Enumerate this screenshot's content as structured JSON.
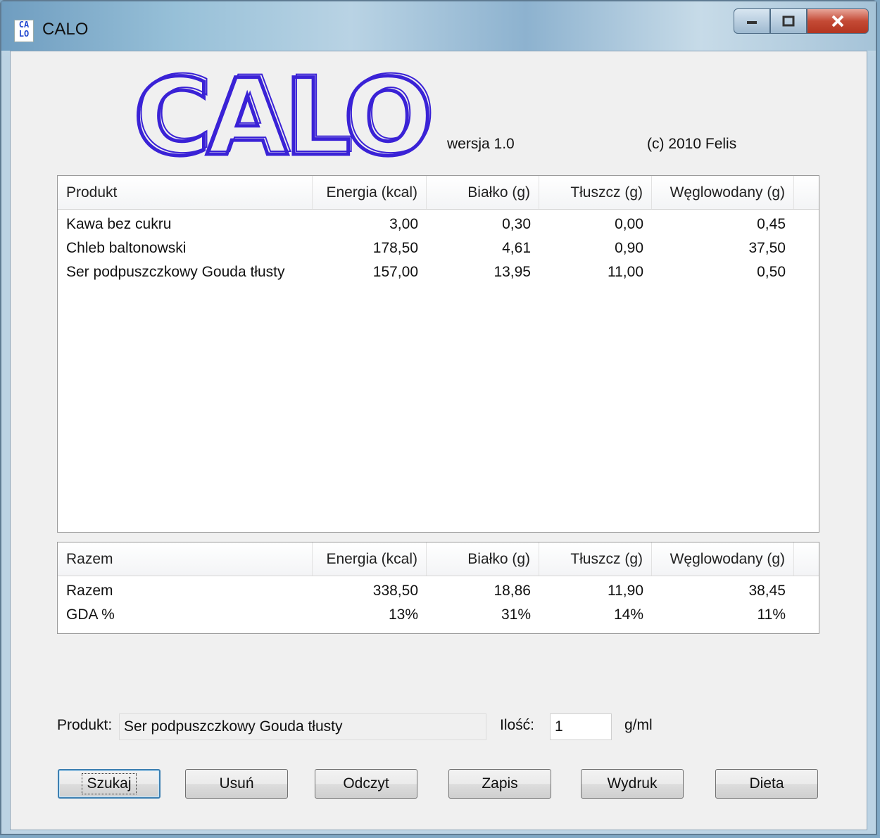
{
  "window": {
    "title": "CALO",
    "icon_text_top": "CA",
    "icon_text_bottom": "LO"
  },
  "header": {
    "logo_text": "CALO",
    "logo_color": "#3a22d6",
    "version": "wersja 1.0",
    "copyright": "(c) 2010 Felis"
  },
  "products_table": {
    "columns": [
      "Produkt",
      "Energia (kcal)",
      "Białko (g)",
      "Tłuszcz (g)",
      "Węglowodany (g)"
    ],
    "rows": [
      [
        "Kawa bez cukru",
        "3,00",
        "0,30",
        "0,00",
        "0,45"
      ],
      [
        "Chleb baltonowski",
        "178,50",
        "4,61",
        "0,90",
        "37,50"
      ],
      [
        "Ser podpuszczkowy Gouda tłusty",
        "157,00",
        "13,95",
        "11,00",
        "0,50"
      ]
    ]
  },
  "totals_table": {
    "columns": [
      "Razem",
      "Energia (kcal)",
      "Białko (g)",
      "Tłuszcz (g)",
      "Węglowodany (g)"
    ],
    "rows": [
      [
        "Razem",
        "338,50",
        "18,86",
        "11,90",
        "38,45"
      ],
      [
        "GDA %",
        "13%",
        "31%",
        "14%",
        "11%"
      ]
    ]
  },
  "entry": {
    "product_label": "Produkt:",
    "product_value": "Ser podpuszczkowy Gouda tłusty",
    "quantity_label": "Ilość:",
    "quantity_value": "1",
    "unit_label": "g/ml"
  },
  "buttons": {
    "search": "Szukaj",
    "delete": "Usuń",
    "read": "Odczyt",
    "save": "Zapis",
    "print": "Wydruk",
    "diet": "Dieta"
  }
}
